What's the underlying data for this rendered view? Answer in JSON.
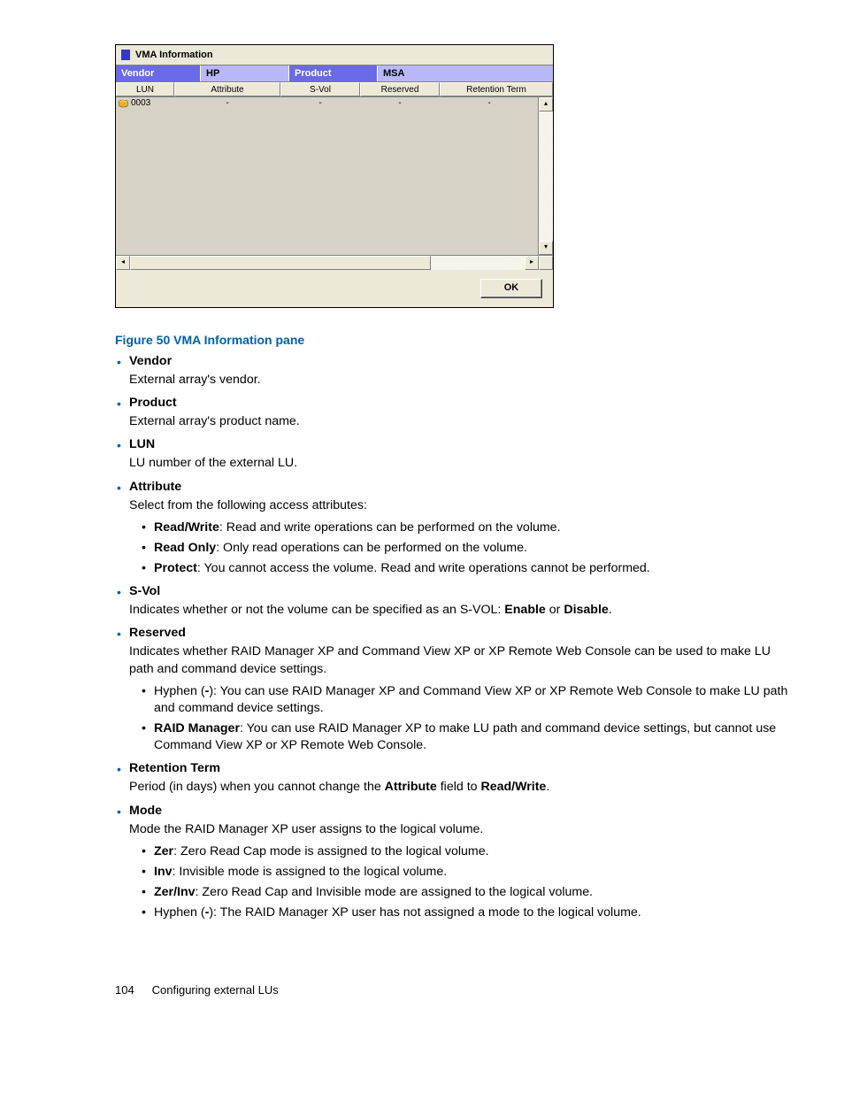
{
  "vma": {
    "title": "VMA Information",
    "header": {
      "vendor_label": "Vendor",
      "vendor_value": "HP",
      "product_label": "Product",
      "product_value": "MSA"
    },
    "columns": [
      "LUN",
      "Attribute",
      "S-Vol",
      "Reserved",
      "Retention Term"
    ],
    "rows": [
      {
        "lun": "0003",
        "attribute": "-",
        "svol": "-",
        "reserved": "-",
        "retention": "-"
      }
    ],
    "ok_label": "OK"
  },
  "caption": "Figure 50 VMA Information pane",
  "items": {
    "vendor": {
      "h": "Vendor",
      "d": "External array's vendor."
    },
    "product": {
      "h": "Product",
      "d": "External array's product name."
    },
    "lun": {
      "h": "LUN",
      "d": "LU number of the external LU."
    },
    "attribute": {
      "h": "Attribute",
      "d": "Select from the following access attributes:"
    },
    "attr_rw": {
      "b": "Read/Write",
      "t": ": Read and write operations can be performed on the volume."
    },
    "attr_ro": {
      "b": "Read Only",
      "t": ": Only read operations can be performed on the volume."
    },
    "attr_protect": {
      "b": "Protect",
      "t": ": You cannot access the volume. Read and write operations cannot be performed."
    },
    "svol": {
      "h": "S-Vol",
      "d_pre": "Indicates whether or not the volume can be specified as an S-VOL: ",
      "b1": "Enable",
      "mid": " or ",
      "b2": "Disable",
      "post": "."
    },
    "reserved": {
      "h": "Reserved",
      "d": "Indicates whether RAID Manager XP and Command View XP or XP Remote Web Console can be used to make LU path and command device settings."
    },
    "res_hyphen": {
      "pre": "Hyphen (",
      "b": "-",
      "post": "): You can use RAID Manager XP and Command View XP or XP Remote Web Console to make LU path and command device settings."
    },
    "res_rm": {
      "b": "RAID Manager",
      "t": ": You can use RAID Manager XP to make LU path and command device settings, but cannot use Command View XP or XP Remote Web Console."
    },
    "retention": {
      "h": "Retention Term",
      "d_pre": "Period (in days) when you cannot change the ",
      "b1": "Attribute",
      "mid": " field to ",
      "b2": "Read/Write",
      "post": "."
    },
    "mode": {
      "h": "Mode",
      "d": "Mode the RAID Manager XP user assigns to the logical volume."
    },
    "mode_zer": {
      "b": "Zer",
      "t": ": Zero Read Cap mode is assigned to the logical volume."
    },
    "mode_inv": {
      "b": "Inv",
      "t": ": Invisible mode is assigned to the logical volume."
    },
    "mode_zerinv": {
      "b": "Zer/Inv",
      "t": ": Zero Read Cap and Invisible mode are assigned to the logical volume."
    },
    "mode_hyphen": {
      "pre": "Hyphen (",
      "b": "-",
      "post": "): The RAID Manager XP user has not assigned a mode to the logical volume."
    }
  },
  "footer": {
    "page": "104",
    "title": "Configuring external LUs"
  }
}
